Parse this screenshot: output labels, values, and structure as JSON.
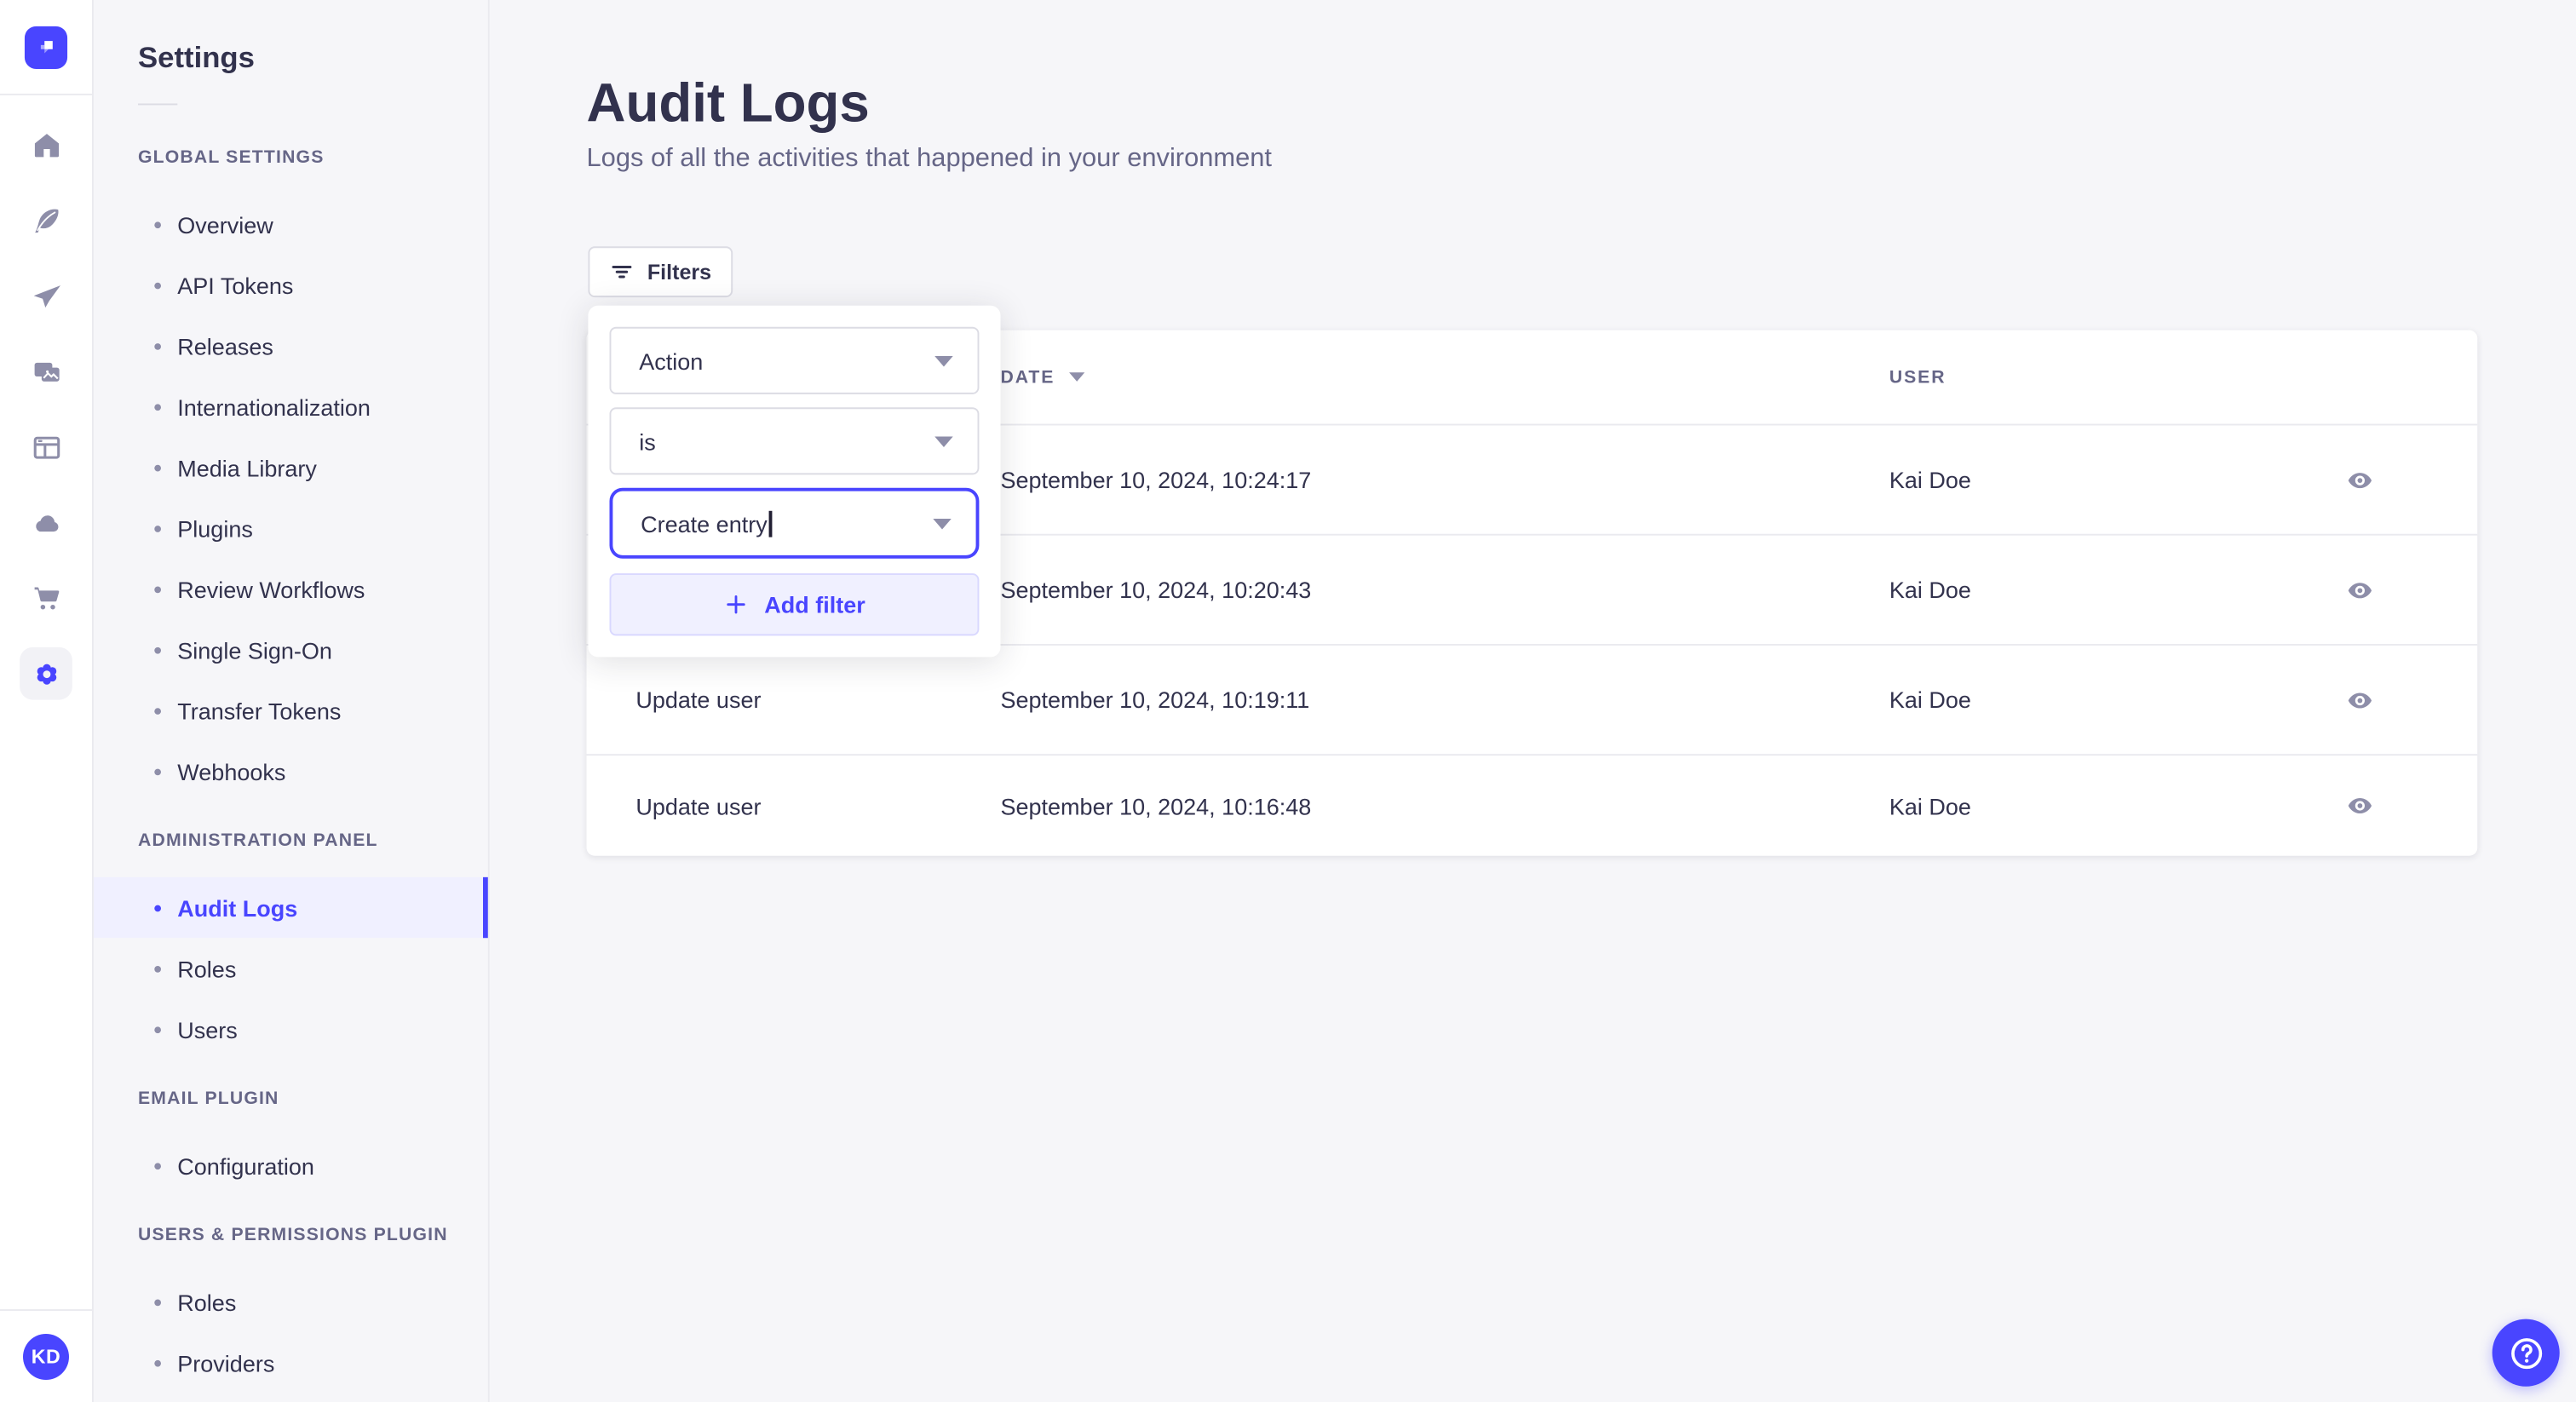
{
  "brand": {
    "logo_icon": "strapi-logo-icon",
    "accent_color": "#4945ff",
    "accent_light": "#f0f0ff",
    "text_dark": "#32324d",
    "text_gray": "#666687",
    "icon_gray": "#8e8ea9",
    "border": "#dcdce4",
    "hairline": "#eaeaef",
    "background": "#f6f6f9"
  },
  "rail": {
    "icons": [
      {
        "name": "home-icon"
      },
      {
        "name": "feather-icon"
      },
      {
        "name": "send-icon"
      },
      {
        "name": "media-library-icon"
      },
      {
        "name": "layout-icon"
      },
      {
        "name": "cloud-icon"
      },
      {
        "name": "marketplace-cart-icon"
      },
      {
        "name": "settings-gear-icon",
        "active": true
      }
    ],
    "avatar_initials": "KD"
  },
  "sidebar": {
    "title": "Settings",
    "sections": [
      {
        "label": "GLOBAL SETTINGS",
        "items": [
          {
            "label": "Overview"
          },
          {
            "label": "API Tokens"
          },
          {
            "label": "Releases"
          },
          {
            "label": "Internationalization"
          },
          {
            "label": "Media Library"
          },
          {
            "label": "Plugins"
          },
          {
            "label": "Review Workflows"
          },
          {
            "label": "Single Sign-On"
          },
          {
            "label": "Transfer Tokens"
          },
          {
            "label": "Webhooks"
          }
        ]
      },
      {
        "label": "ADMINISTRATION PANEL",
        "items": [
          {
            "label": "Audit Logs",
            "active": true
          },
          {
            "label": "Roles"
          },
          {
            "label": "Users"
          }
        ]
      },
      {
        "label": "EMAIL PLUGIN",
        "items": [
          {
            "label": "Configuration"
          }
        ]
      },
      {
        "label": "USERS & PERMISSIONS PLUGIN",
        "items": [
          {
            "label": "Roles"
          },
          {
            "label": "Providers"
          }
        ]
      }
    ]
  },
  "page": {
    "title": "Audit Logs",
    "subtitle": "Logs of all the activities that happened in your environment"
  },
  "toolbar": {
    "filters_label": "Filters",
    "filter_icon": "filter-lines-icon"
  },
  "filter_popover": {
    "field_value": "Action",
    "operator_value": "is",
    "action_value": "Create entry",
    "add_filter_label": "Add filter",
    "add_icon": "plus-icon",
    "caret_icon": "caret-down-icon"
  },
  "table": {
    "columns": {
      "action_label": "",
      "date_label": "DATE",
      "user_label": "USER",
      "sort_icon": "sort-desc-caret-icon"
    },
    "row_action_icon": "eye-icon",
    "rows": [
      {
        "action": "",
        "date": "September 10, 2024, 10:24:17",
        "user": "Kai Doe"
      },
      {
        "action": "",
        "date": "September 10, 2024, 10:20:43",
        "user": "Kai Doe"
      },
      {
        "action": "Update user",
        "date": "September 10, 2024, 10:19:11",
        "user": "Kai Doe"
      },
      {
        "action": "Update user",
        "date": "September 10, 2024, 10:16:48",
        "user": "Kai Doe"
      }
    ]
  },
  "help": {
    "icon": "question-circle-icon"
  }
}
